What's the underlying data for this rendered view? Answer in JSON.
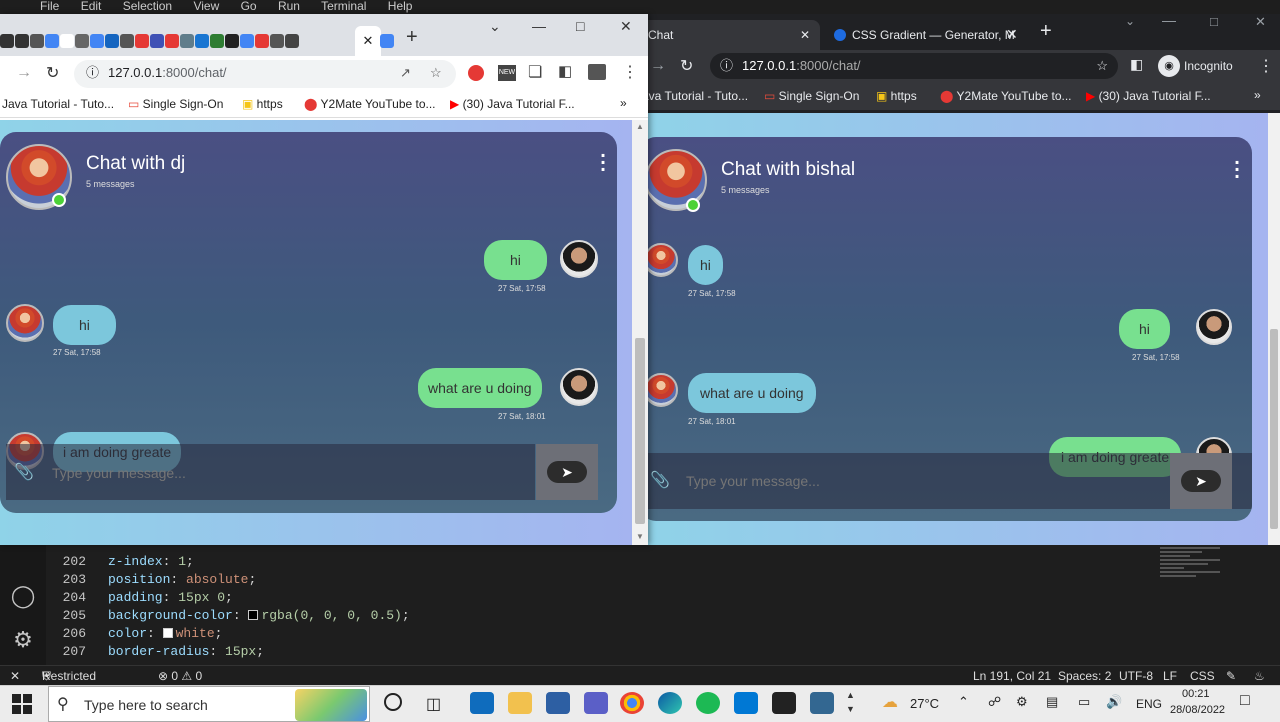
{
  "vscode": {
    "menu": [
      "File",
      "Edit",
      "Selection",
      "View",
      "Go",
      "Run",
      "Terminal",
      "Help"
    ],
    "code_lines": [
      {
        "no": "202",
        "prop": "z-index",
        "val": "1",
        "type": "num"
      },
      {
        "no": "203",
        "prop": "position",
        "val": "absolute",
        "type": "str"
      },
      {
        "no": "204",
        "prop": "padding",
        "val": "15px 0",
        "type": "num"
      },
      {
        "no": "205",
        "prop": "background-color",
        "val": "rgba(0, 0, 0, 0.5)",
        "type": "swatch",
        "swatch": "#000000"
      },
      {
        "no": "206",
        "prop": "color",
        "val": "white",
        "type": "swatch-str",
        "swatch": "#ffffff"
      },
      {
        "no": "207",
        "prop": "border-radius",
        "val": "15px",
        "type": "num"
      }
    ],
    "status": {
      "restricted": "Restricted Mode",
      "problems": "⊗ 0 ⚠ 0",
      "position": "Ln 191, Col 21",
      "spaces": "Spaces: 2",
      "encoding": "UTF-8",
      "eol": "LF",
      "language": "CSS"
    }
  },
  "left_window": {
    "url_host": "127.0.0.1",
    "url_path": ":8000/chat/",
    "bookmarks": [
      "Java Tutorial - Tuto...",
      "Single Sign-On",
      "https",
      "Y2Mate YouTube to...",
      "(30) Java Tutorial F..."
    ],
    "chat": {
      "title": "Chat with dj",
      "subtitle": "5 messages",
      "messages": [
        {
          "dir": "out",
          "text": "hi",
          "time": "27 Sat, 17:58"
        },
        {
          "dir": "in",
          "text": "hi",
          "time": "27 Sat, 17:58"
        },
        {
          "dir": "out",
          "text": "what are u doing",
          "time": "27 Sat, 18:01"
        },
        {
          "dir": "in",
          "text": "i am doing greate",
          "time": ""
        }
      ],
      "placeholder": "Type your message..."
    }
  },
  "right_window": {
    "tabs": [
      {
        "label": "Chat"
      },
      {
        "label": "CSS Gradient — Generator, M"
      }
    ],
    "url_host": "127.0.0.1",
    "url_path": ":8000/chat/",
    "incognito": "Incognito",
    "bookmarks": [
      "ava Tutorial - Tuto...",
      "Single Sign-On",
      "https",
      "Y2Mate YouTube to...",
      "(30) Java Tutorial F..."
    ],
    "chat": {
      "title": "Chat with bishal",
      "subtitle": "5 messages",
      "messages": [
        {
          "dir": "in",
          "text": "hi",
          "time": "27 Sat, 17:58"
        },
        {
          "dir": "out",
          "text": "hi",
          "time": "27 Sat, 17:58"
        },
        {
          "dir": "in",
          "text": "what are u doing",
          "time": "27 Sat, 18:01"
        },
        {
          "dir": "out",
          "text": "i am doing greate",
          "time": ""
        }
      ],
      "placeholder": "Type your message..."
    }
  },
  "taskbar": {
    "search_placeholder": "Type here to search",
    "weather": "27°C",
    "lang": "ENG",
    "time": "00:21",
    "date": "28/08/2022"
  }
}
